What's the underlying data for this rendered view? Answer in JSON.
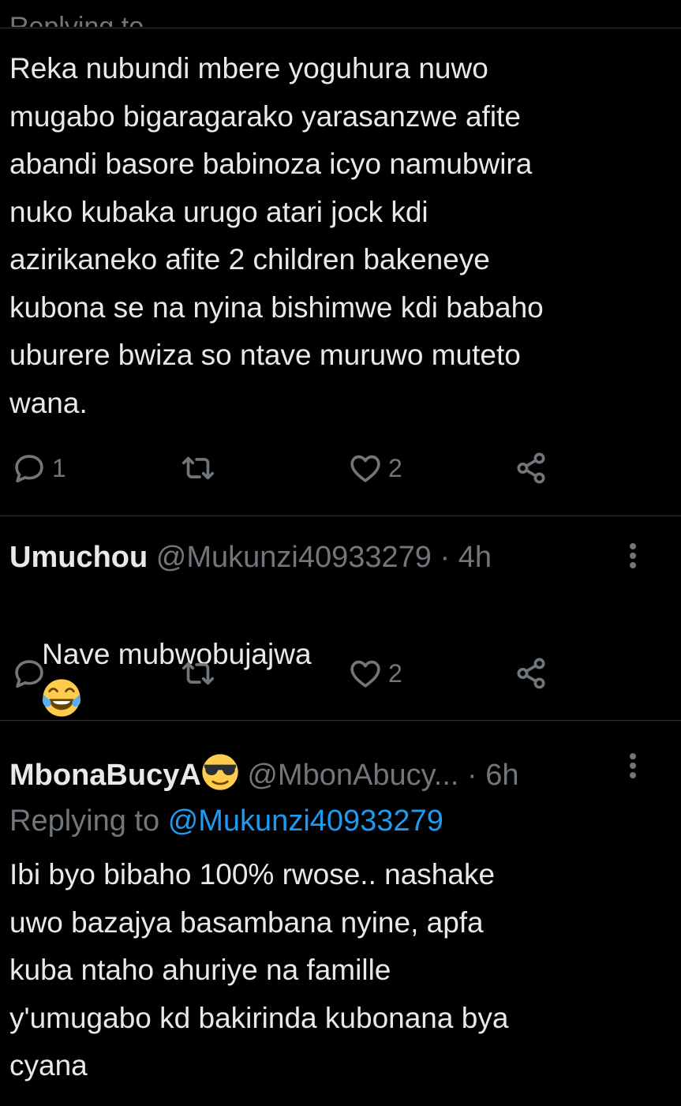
{
  "clipped_top_text": "Replying to",
  "tweet1": {
    "lines": [
      "Reka nubundi mbere yoguhura nuwo",
      "mugabo bigaragarako yarasanzwe afite",
      "abandi basore babinoza icyo namubwira",
      "nuko kubaka urugo atari jock kdi",
      "azirikaneko afite 2 children bakeneye",
      "kubona se na nyina bishimwe kdi babaho",
      "uburere bwiza so ntave muruwo muteto",
      "wana."
    ],
    "actions": {
      "reply_count": "1",
      "retweet_count": "",
      "like_count": "2"
    }
  },
  "tweet2": {
    "display_name": "Umuchou",
    "handle": "@Mukunzi40933279",
    "time": "· 4h",
    "text": "Nave mubwobujajwa",
    "emoji": "tears-of-joy-emoji",
    "actions": {
      "reply_count": "",
      "retweet_count": "",
      "like_count": "2"
    }
  },
  "tweet3": {
    "display_name": "MbonaBucyA",
    "name_emoji": "sunglasses-emoji",
    "handle": "@MbonAbucy...",
    "time": "· 6h",
    "replying_label": "Replying to",
    "replying_handle": "@Mukunzi40933279",
    "lines": [
      "Ibi byo bibaho 100% rwose.. nashake",
      "uwo bazajya basambana nyine, apfa",
      "kuba ntaho ahuriye na famille",
      "y'umugabo kd bakirinda kubonana bya",
      "cyana"
    ]
  },
  "colors": {
    "background": "#000000",
    "text": "#e7e9ea",
    "muted": "#71767b",
    "link": "#1d9bf0",
    "divider": "#2f3336"
  }
}
